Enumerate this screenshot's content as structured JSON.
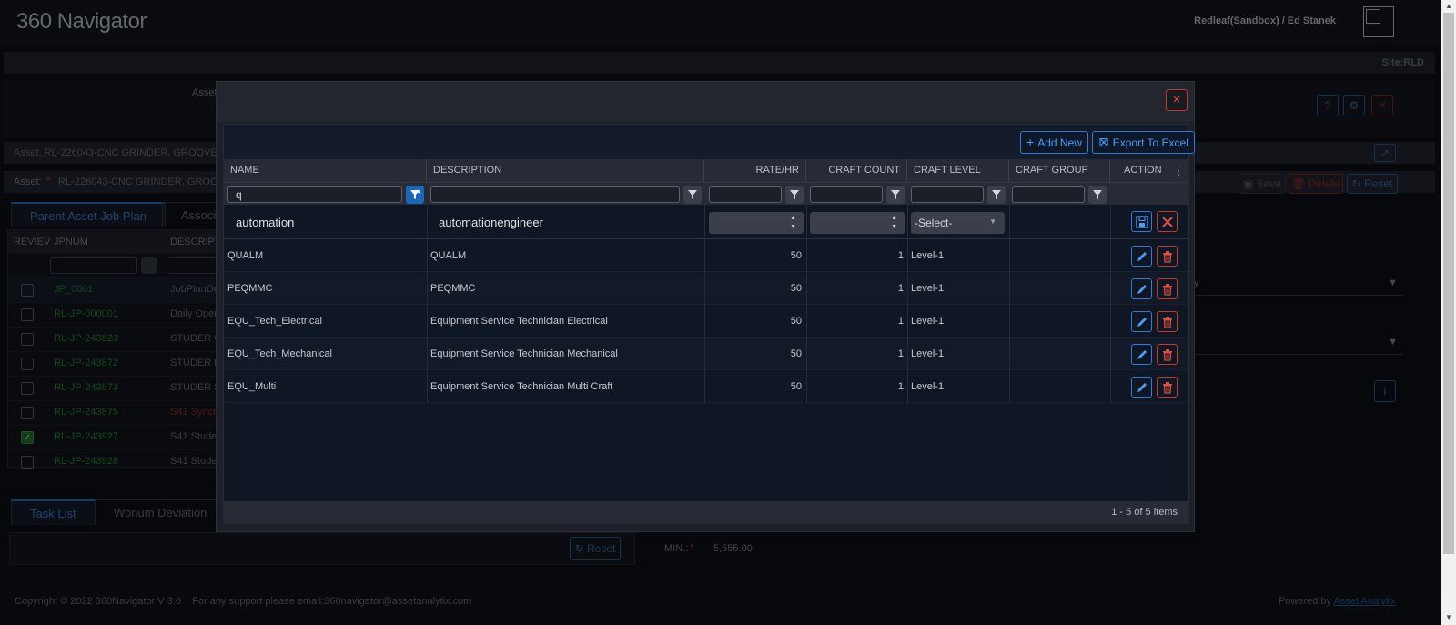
{
  "app": {
    "logo": "360 Navigator",
    "user": "Redleaf(Sandbox) / Ed Stanek",
    "site": "Site:RLD"
  },
  "background": {
    "asset_label_1": "Asset: RL-226043-CNC GRINDER, GROOVE",
    "asset_label_2_prefix": "Asset:",
    "asset_label_2_req": "*",
    "asset_label_2_value": "RL-226043-CNC GRINDER, GROOV",
    "asset_field_label": "Asset",
    "save_label": "Save",
    "delete_label": "Delete",
    "reset_label": "Reset",
    "tabs": {
      "parent": "Parent Asset Job Plan",
      "second": "Associa"
    },
    "grid_headers": {
      "review": "REVIEV",
      "jpnum": "JPNUM",
      "desc": "DESCRIPT"
    },
    "rows": [
      {
        "jp": "JP_0001",
        "desc": "JobPlanDe"
      },
      {
        "jp": "RL-JP-000001",
        "desc": "Daily Oper"
      },
      {
        "jp": "RL-JP-243823",
        "desc": "STUDER G"
      },
      {
        "jp": "RL-JP-243872",
        "desc": "STUDER P"
      },
      {
        "jp": "RL-JP-243873",
        "desc": "STUDER S"
      },
      {
        "jp": "RL-JP-243875",
        "desc": "S41 Synch"
      },
      {
        "jp": "RL-JP-243927",
        "desc": "S41 Studer"
      },
      {
        "jp": "RL-JP-243928",
        "desc": "S41 Studer"
      }
    ],
    "bottom_tabs": {
      "task_list": "Task List",
      "wonum_deviation": "Wonum Deviation"
    },
    "bottom_reset": "Reset",
    "right_dropdown_1": "y",
    "min_label": "MIN.:",
    "min_req": "*",
    "min_value": "5,555.00",
    "copyright": "Copyright © 2022 360Navigator V 3.0",
    "support": "For any support please email:360navigator@assetanalytix.com",
    "powered_by": "Powered by",
    "powered_link": "Asset Analytix"
  },
  "modal": {
    "close_icon": "×",
    "toolbar": {
      "add_new": "Add New",
      "export_excel": "Export To Excel"
    },
    "columns": {
      "name": "NAME",
      "description": "DESCRIPTION",
      "rate": "RATE/HR",
      "craft_count": "CRAFT COUNT",
      "craft_level": "CRAFT LEVEL",
      "craft_group": "CRAFT GROUP",
      "action": "ACTION"
    },
    "filter": {
      "name_value": "q"
    },
    "edit_row": {
      "name": "automation",
      "description": "automationengineer",
      "level_select": "-Select-"
    },
    "rows": [
      {
        "name": "QUALM",
        "description": "QUALM",
        "rate": "50",
        "count": "1",
        "level": "Level-1",
        "group": ""
      },
      {
        "name": "PEQMMC",
        "description": "PEQMMC",
        "rate": "50",
        "count": "1",
        "level": "Level-1",
        "group": ""
      },
      {
        "name": "EQU_Tech_Electrical",
        "description": "Equipment Service Technician Electrical",
        "rate": "50",
        "count": "1",
        "level": "Level-1",
        "group": ""
      },
      {
        "name": "EQU_Tech_Mechanical",
        "description": "Equipment Service Technician Mechanical",
        "rate": "50",
        "count": "1",
        "level": "Level-1",
        "group": ""
      },
      {
        "name": "EQU_Multi",
        "description": "Equipment Service Technician Multi Craft",
        "rate": "50",
        "count": "1",
        "level": "Level-1",
        "group": ""
      }
    ],
    "pager": "1 - 5 of 5 items"
  },
  "colors": {
    "accent": "#2f7ad6",
    "danger": "#e04e3e",
    "success": "#1e6e2a"
  }
}
